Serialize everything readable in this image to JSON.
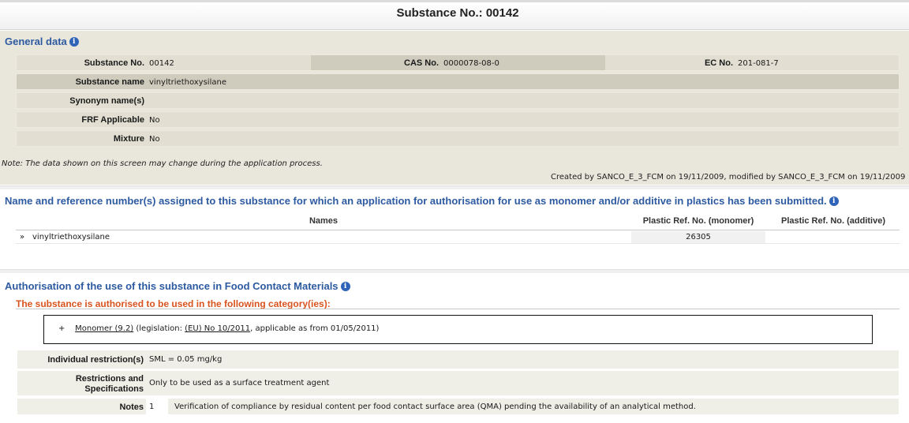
{
  "page": {
    "title": "Substance No.: 00142"
  },
  "general": {
    "title": "General data",
    "info_icon": "info-icon",
    "substance_no_label": "Substance No.",
    "substance_no": "00142",
    "cas_label": "CAS No.",
    "cas": "0000078-08-0",
    "ec_label": "EC No.",
    "ec": "201-081-7",
    "name_label": "Substance name",
    "name": "vinyltriethoxysilane",
    "synonym_label": "Synonym name(s)",
    "synonym": "",
    "frf_label": "FRF Applicable",
    "frf": "No",
    "mixture_label": "Mixture",
    "mixture": "No",
    "note": "Note: The data shown on this screen may change during the application process.",
    "created": "Created by SANCO_E_3_FCM on 19/11/2009, modified by SANCO_E_3_FCM on 19/11/2009"
  },
  "names_section": {
    "title": "Name and reference number(s) assigned to this substance for which an application for authorisation for use as monomer and/or additive in plastics has been submitted.",
    "headers": [
      "Names",
      "Plastic Ref. No. (monomer)",
      "Plastic Ref. No. (additive)"
    ],
    "rows": [
      {
        "marker": "»",
        "name": "vinyltriethoxysilane",
        "monomer_ref": "26305",
        "additive_ref": ""
      }
    ]
  },
  "auth": {
    "title": "Authorisation of the use of this substance in Food Contact Materials",
    "subtitle": "The substance is authorised to be used in the following category(ies):",
    "category": {
      "expander": "+",
      "name": "Monomer (9.2)",
      "legis_prefix": " (legislation: ",
      "legislation": "(EU) No 10/2011",
      "legis_suffix": ", applicable as from 01/05/2011)"
    },
    "restriction_label": "Individual restriction(s)",
    "restriction": "SML = 0.05 mg/kg",
    "specs_label_1": "Restrictions and",
    "specs_label_2": "Specifications",
    "specs": "Only to be used as a surface treatment agent",
    "notes_label": "Notes",
    "note_number": "1",
    "note_text": "Verification of compliance by residual content per food contact surface area (QMA) pending the availability of an analytical method."
  },
  "colors": {
    "accent_blue": "#2d5aa0",
    "warning_orange": "#d9531e",
    "panel_beige": "#e9e6dc"
  }
}
